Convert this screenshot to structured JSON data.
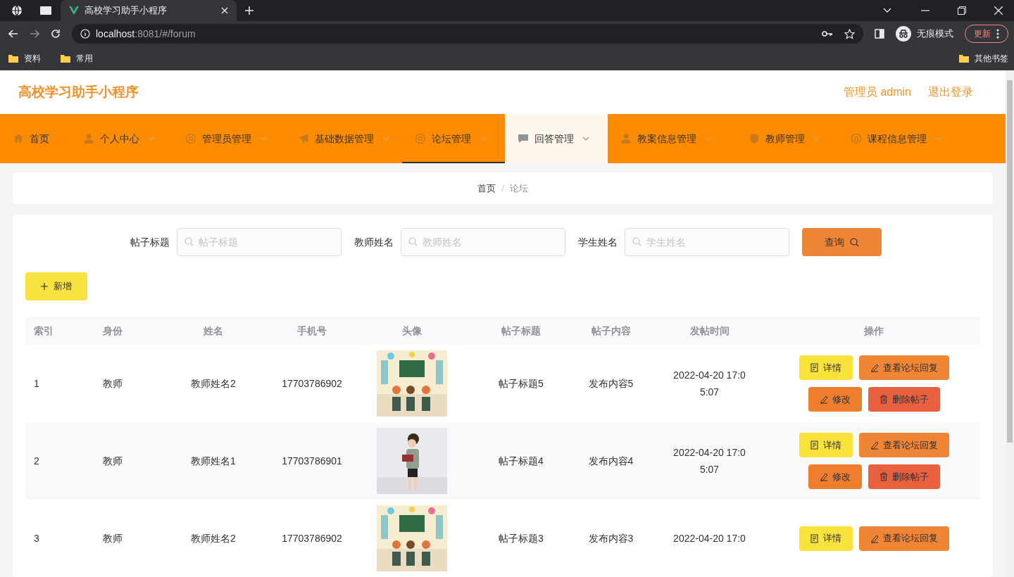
{
  "browser": {
    "tabs": [
      {
        "title": "高校学习助手小程序",
        "selected": true
      }
    ],
    "url": {
      "host": "localhost",
      "path": ":8081/#/forum"
    },
    "profile_label": "无痕模式",
    "update_button": "更新",
    "bookmarks": [
      "资料",
      "常用"
    ],
    "other_bookmarks": "其他书签"
  },
  "header": {
    "title": "高校学习助手小程序",
    "user": "管理员 admin",
    "logout": "退出登录"
  },
  "nav": [
    {
      "label": "首页",
      "selected": false,
      "hovered": false,
      "dropdown": false
    },
    {
      "label": "个人中心",
      "selected": false,
      "hovered": false,
      "dropdown": true
    },
    {
      "label": "管理员管理",
      "selected": false,
      "hovered": false,
      "dropdown": true
    },
    {
      "label": "基础数据管理",
      "selected": false,
      "hovered": false,
      "dropdown": true
    },
    {
      "label": "论坛管理",
      "selected": true,
      "hovered": false,
      "dropdown": true
    },
    {
      "label": "回答管理",
      "selected": false,
      "hovered": true,
      "dropdown": true
    },
    {
      "label": "教案信息管理",
      "selected": false,
      "hovered": false,
      "dropdown": true
    },
    {
      "label": "教师管理",
      "selected": false,
      "hovered": false,
      "dropdown": true
    },
    {
      "label": "课程信息管理",
      "selected": false,
      "hovered": false,
      "dropdown": true
    }
  ],
  "breadcrumb": {
    "items": [
      "首页",
      "论坛"
    ],
    "separator": "/"
  },
  "filters": [
    {
      "label": "帖子标题",
      "placeholder": "帖子标题"
    },
    {
      "label": "教师姓名",
      "placeholder": "教师姓名"
    },
    {
      "label": "学生姓名",
      "placeholder": "学生姓名"
    }
  ],
  "search_button": "查询",
  "add_button": "新增",
  "table": {
    "columns": [
      "索引",
      "身份",
      "姓名",
      "手机号",
      "头像",
      "帖子标题",
      "帖子内容",
      "发帖时间",
      "操作"
    ],
    "rows": [
      {
        "index": "1",
        "role": "教师",
        "name": "教师姓名2",
        "phone": "17703786902",
        "avatar": {
          "kind": "picture"
        },
        "post_title": "帖子标题5",
        "post_content": "发布内容5",
        "posted_at": "2022-04-20 17:05:07",
        "actions": [
          {
            "label": "详情",
            "kind": "detail"
          },
          {
            "label": "查看论坛回复",
            "kind": "replies"
          },
          {
            "label": "修改",
            "kind": "edit"
          },
          {
            "label": "删除帖子",
            "kind": "delete"
          }
        ]
      },
      {
        "index": "2",
        "role": "教师",
        "name": "教师姓名1",
        "phone": "17703786901",
        "avatar": {
          "kind": "picture"
        },
        "post_title": "帖子标题4",
        "post_content": "发布内容4",
        "posted_at": "2022-04-20 17:05:07",
        "actions": [
          {
            "label": "详情",
            "kind": "detail"
          },
          {
            "label": "查看论坛回复",
            "kind": "replies"
          },
          {
            "label": "修改",
            "kind": "edit"
          },
          {
            "label": "删除帖子",
            "kind": "delete"
          }
        ]
      },
      {
        "index": "3",
        "role": "教师",
        "name": "教师姓名2",
        "phone": "17703786902",
        "avatar": {
          "kind": "picture"
        },
        "post_title": "帖子标题3",
        "post_content": "发布内容3",
        "posted_at": "2022-04-20 17:0",
        "actions": [
          {
            "label": "详情",
            "kind": "detail"
          },
          {
            "label": "查看论坛回复",
            "kind": "replies"
          }
        ]
      }
    ]
  }
}
